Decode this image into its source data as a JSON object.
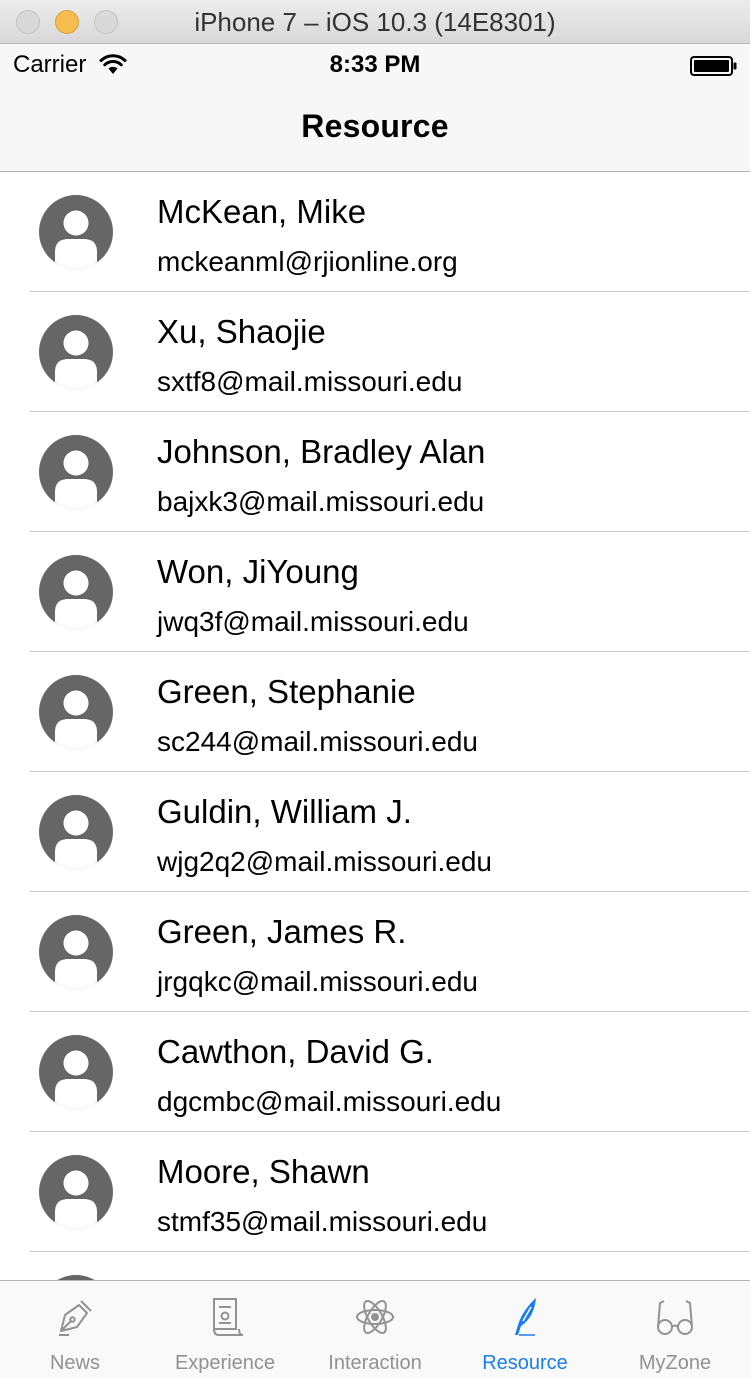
{
  "window": {
    "title": "iPhone 7 – iOS 10.3 (14E8301)"
  },
  "status_bar": {
    "carrier": "Carrier",
    "time": "8:33 PM"
  },
  "nav": {
    "title": "Resource"
  },
  "contacts": [
    {
      "name": "McKean, Mike",
      "email": "mckeanml@rjionline.org"
    },
    {
      "name": "Xu, Shaojie",
      "email": "sxtf8@mail.missouri.edu"
    },
    {
      "name": "Johnson, Bradley Alan",
      "email": "bajxk3@mail.missouri.edu"
    },
    {
      "name": "Won, JiYoung",
      "email": "jwq3f@mail.missouri.edu"
    },
    {
      "name": "Green, Stephanie",
      "email": "sc244@mail.missouri.edu"
    },
    {
      "name": "Guldin, William J.",
      "email": "wjg2q2@mail.missouri.edu"
    },
    {
      "name": "Green, James R.",
      "email": "jrgqkc@mail.missouri.edu"
    },
    {
      "name": "Cawthon, David G.",
      "email": "dgcmbc@mail.missouri.edu"
    },
    {
      "name": "Moore, Shawn",
      "email": "stmf35@mail.missouri.edu"
    },
    {
      "name": "",
      "email": ""
    }
  ],
  "tabs": [
    {
      "label": "News",
      "icon": "pen-nib-icon"
    },
    {
      "label": "Experience",
      "icon": "certificate-icon"
    },
    {
      "label": "Interaction",
      "icon": "atom-icon"
    },
    {
      "label": "Resource",
      "icon": "quill-icon",
      "active": true
    },
    {
      "label": "MyZone",
      "icon": "glasses-icon"
    }
  ],
  "colors": {
    "accent": "#1a7cf5",
    "inactive": "#929292",
    "avatar": "#666666"
  }
}
